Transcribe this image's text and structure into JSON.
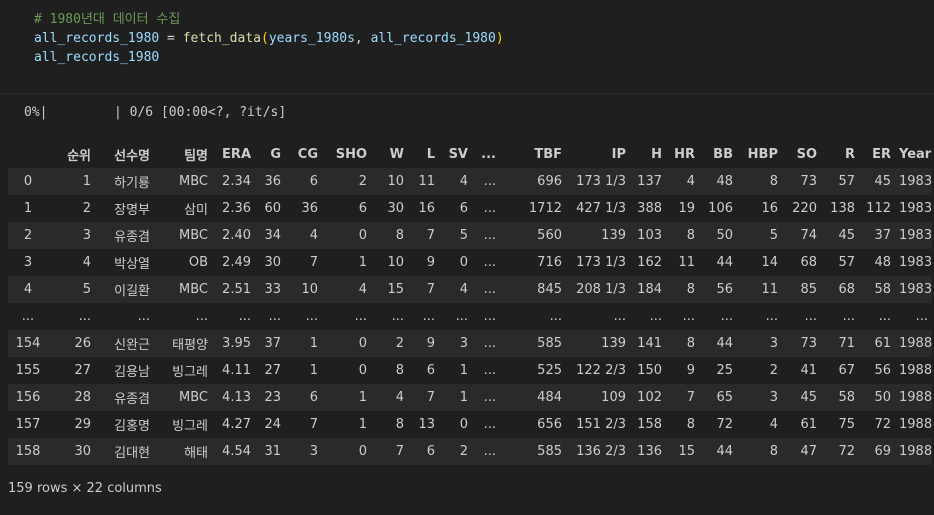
{
  "code": {
    "comment": "# 1980년대 데이터 수집",
    "line2": {
      "var": "all_records_1980",
      "op": " = ",
      "fn": "fetch_data",
      "open": "(",
      "arg1": "years_1980s",
      "sep": ", ",
      "arg2": "all_records_1980",
      "close": ")"
    },
    "line3": "all_records_1980"
  },
  "progress": {
    "percent": "0%|",
    "bar_fraction": 0,
    "status": "| 0/6 [00:00<?, ?it/s]"
  },
  "table": {
    "columns": [
      "",
      "순위",
      "선수명",
      "팀명",
      "ERA",
      "G",
      "CG",
      "SHO",
      "W",
      "L",
      "SV",
      "...",
      "TBF",
      "IP",
      "H",
      "HR",
      "BB",
      "HBP",
      "SO",
      "R",
      "ER",
      "Year"
    ],
    "rows": [
      [
        "0",
        "1",
        "하기룡",
        "MBC",
        "2.34",
        "36",
        "6",
        "2",
        "10",
        "11",
        "4",
        "...",
        "696",
        "173 1/3",
        "137",
        "4",
        "48",
        "8",
        "73",
        "57",
        "45",
        "1983"
      ],
      [
        "1",
        "2",
        "장명부",
        "삼미",
        "2.36",
        "60",
        "36",
        "6",
        "30",
        "16",
        "6",
        "...",
        "1712",
        "427 1/3",
        "388",
        "19",
        "106",
        "16",
        "220",
        "138",
        "112",
        "1983"
      ],
      [
        "2",
        "3",
        "유종겸",
        "MBC",
        "2.40",
        "34",
        "4",
        "0",
        "8",
        "7",
        "5",
        "...",
        "560",
        "139",
        "103",
        "8",
        "50",
        "5",
        "74",
        "45",
        "37",
        "1983"
      ],
      [
        "3",
        "4",
        "박상열",
        "OB",
        "2.49",
        "30",
        "7",
        "1",
        "10",
        "9",
        "0",
        "...",
        "716",
        "173 1/3",
        "162",
        "11",
        "44",
        "14",
        "68",
        "57",
        "48",
        "1983"
      ],
      [
        "4",
        "5",
        "이길환",
        "MBC",
        "2.51",
        "33",
        "10",
        "4",
        "15",
        "7",
        "4",
        "...",
        "845",
        "208 1/3",
        "184",
        "8",
        "56",
        "11",
        "85",
        "68",
        "58",
        "1983"
      ],
      [
        "...",
        "...",
        "...",
        "...",
        "...",
        "...",
        "...",
        "...",
        "...",
        "...",
        "...",
        "...",
        "...",
        "...",
        "...",
        "...",
        "...",
        "...",
        "...",
        "...",
        "...",
        "..."
      ],
      [
        "154",
        "26",
        "신완근",
        "태평양",
        "3.95",
        "37",
        "1",
        "0",
        "2",
        "9",
        "3",
        "...",
        "585",
        "139",
        "141",
        "8",
        "44",
        "3",
        "73",
        "71",
        "61",
        "1988"
      ],
      [
        "155",
        "27",
        "김용남",
        "빙그레",
        "4.11",
        "27",
        "1",
        "0",
        "8",
        "6",
        "1",
        "...",
        "525",
        "122 2/3",
        "150",
        "9",
        "25",
        "2",
        "41",
        "67",
        "56",
        "1988"
      ],
      [
        "156",
        "28",
        "유종겸",
        "MBC",
        "4.13",
        "23",
        "6",
        "1",
        "4",
        "7",
        "1",
        "...",
        "484",
        "109",
        "102",
        "7",
        "65",
        "3",
        "45",
        "58",
        "50",
        "1988"
      ],
      [
        "157",
        "29",
        "김홍명",
        "빙그레",
        "4.27",
        "24",
        "7",
        "1",
        "8",
        "13",
        "0",
        "...",
        "656",
        "151 2/3",
        "158",
        "8",
        "72",
        "4",
        "61",
        "75",
        "72",
        "1988"
      ],
      [
        "158",
        "30",
        "김대현",
        "해태",
        "4.54",
        "31",
        "3",
        "0",
        "7",
        "6",
        "2",
        "...",
        "585",
        "136 2/3",
        "136",
        "15",
        "44",
        "8",
        "47",
        "72",
        "69",
        "1988"
      ]
    ]
  },
  "shape_text": "159 rows × 22 columns"
}
